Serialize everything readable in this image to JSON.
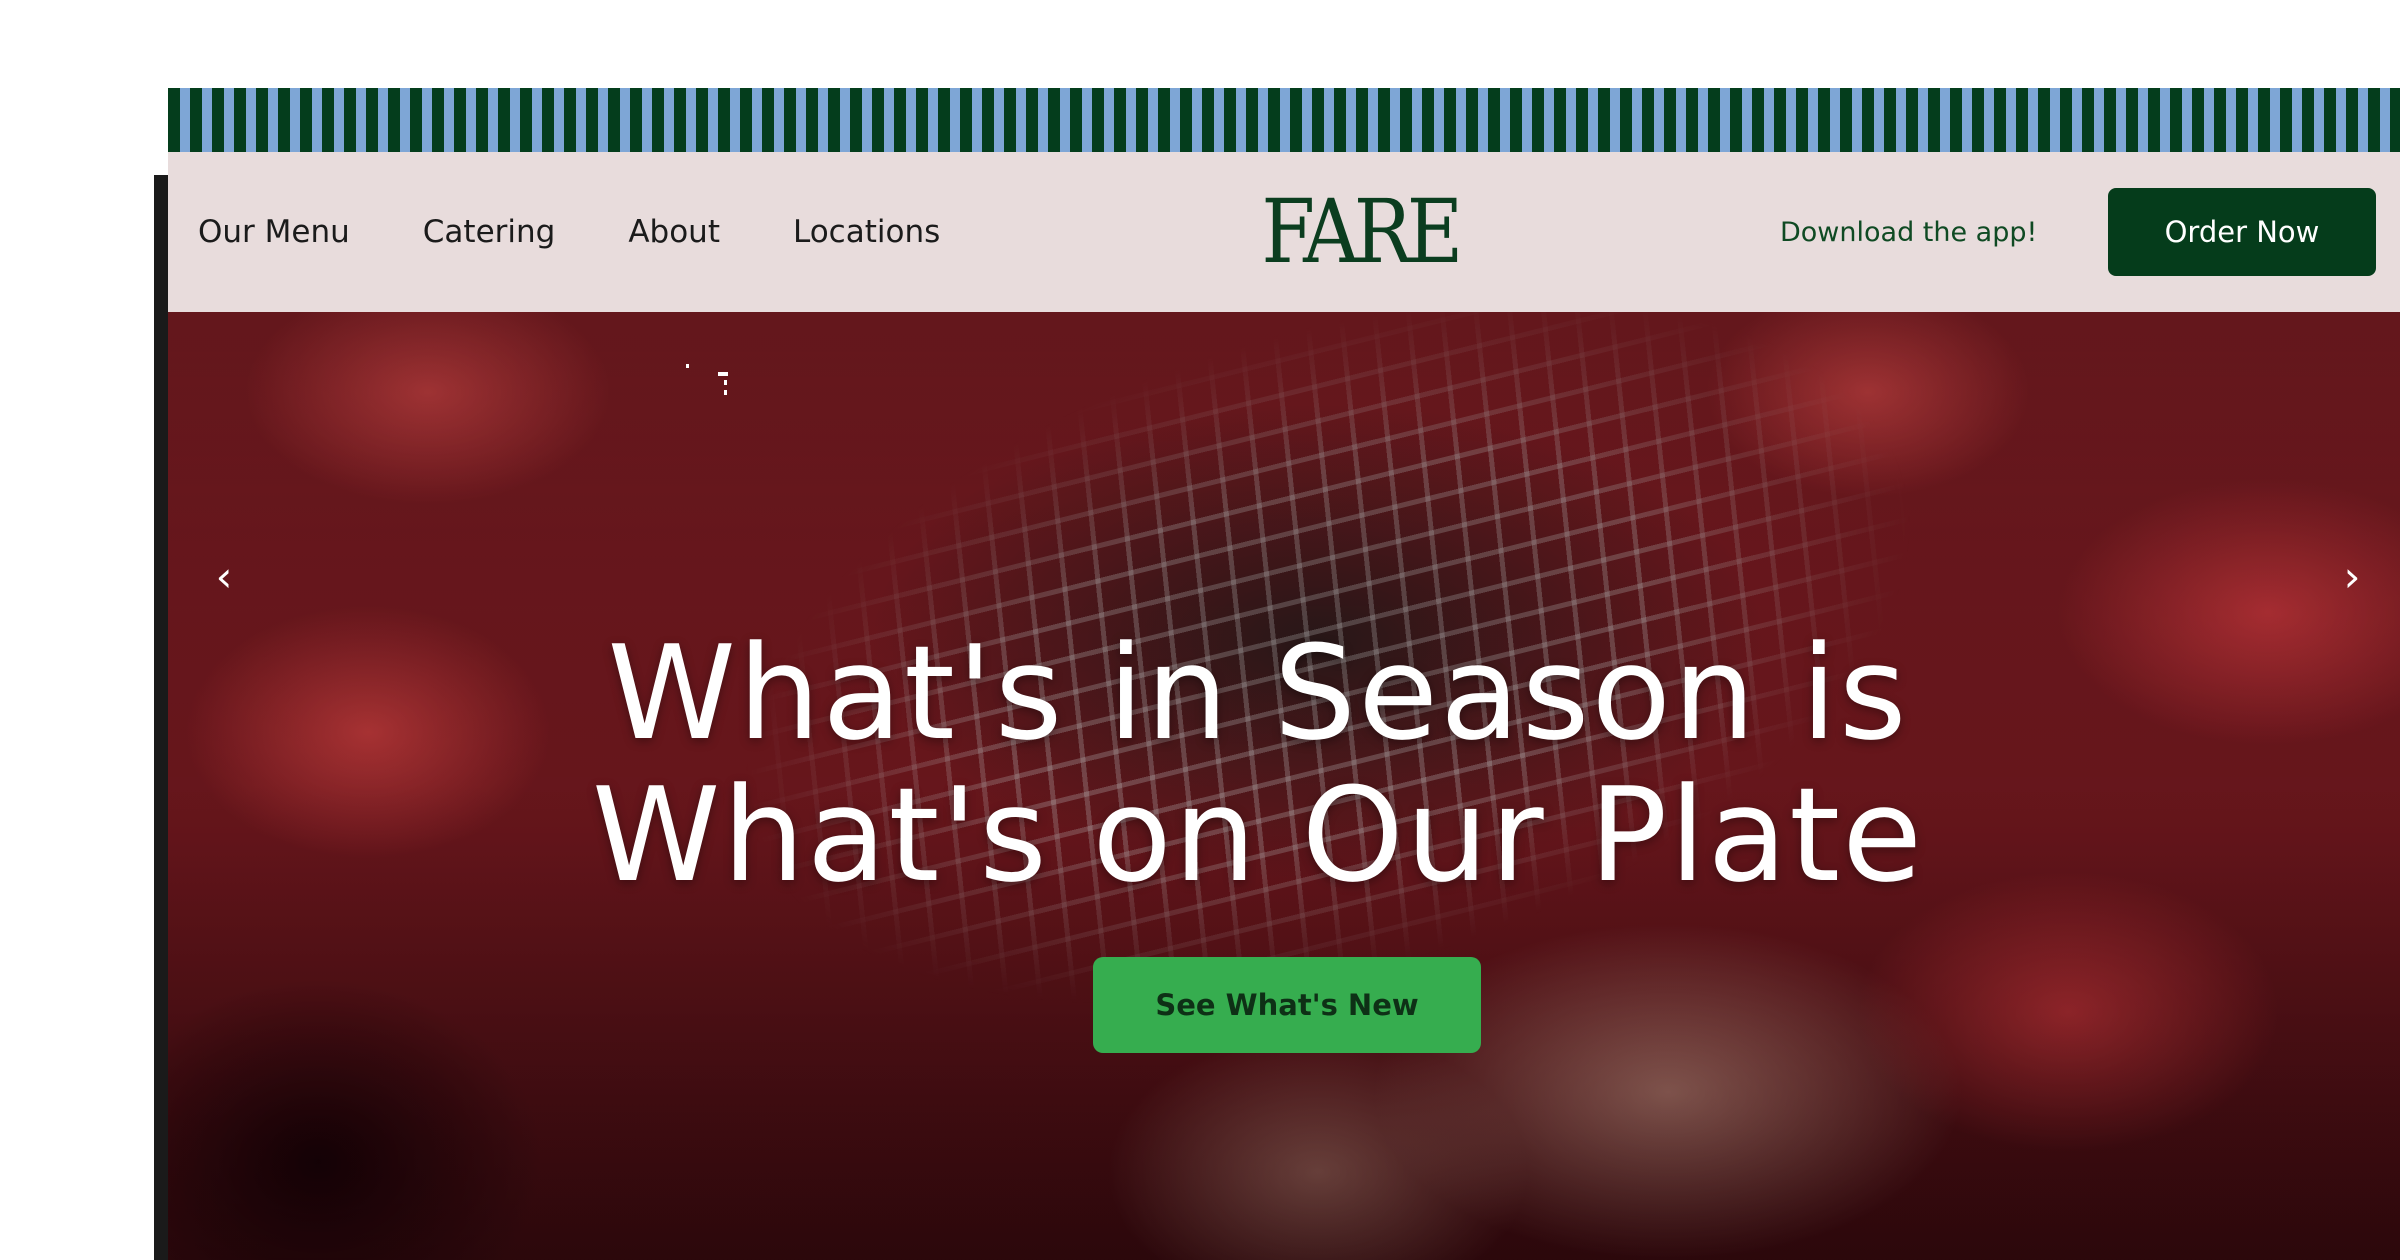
{
  "nav": {
    "links": [
      {
        "label": "Our Menu"
      },
      {
        "label": "Catering"
      },
      {
        "label": "About"
      },
      {
        "label": "Locations"
      }
    ],
    "logo_text": "FARE",
    "download_label": "Download the app!",
    "order_label": "Order Now"
  },
  "hero": {
    "headline_line1": "What's in Season is",
    "headline_line2": "What's on Our Plate",
    "cta_label": "See What's New",
    "prev_arrow": "‹",
    "next_arrow": "›"
  },
  "colors": {
    "brand_green": "#053c1b",
    "cta_green": "#36ad4f",
    "stripe_blue": "#7ea6d6",
    "nav_bg": "#e8dcdc"
  },
  "icons": {
    "prev": "chevron-left-icon",
    "next": "chevron-right-icon"
  }
}
